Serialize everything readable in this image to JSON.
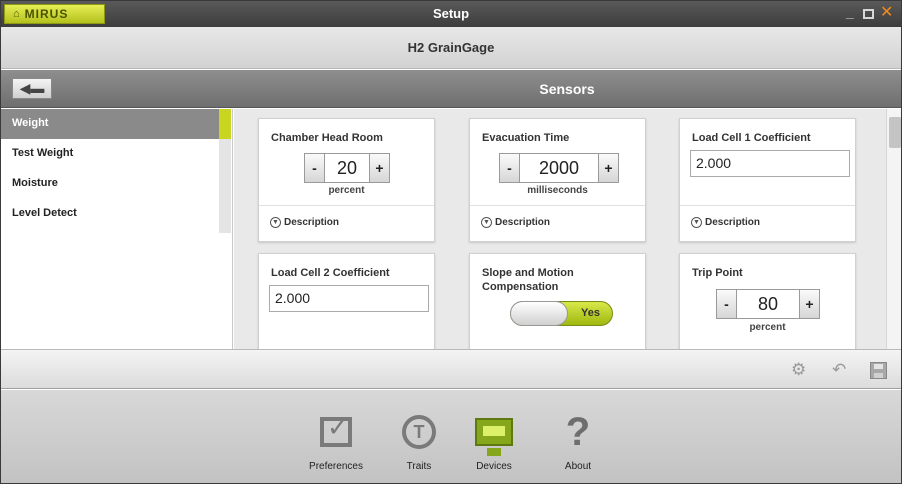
{
  "window": {
    "logo": "MIRUS",
    "title": "Setup"
  },
  "subtitle": "H2 GrainGage",
  "header": {
    "section_title": "Sensors"
  },
  "sidebar": {
    "items": [
      {
        "label": "Weight",
        "active": true
      },
      {
        "label": "Test Weight",
        "active": false
      },
      {
        "label": "Moisture",
        "active": false
      },
      {
        "label": "Level Detect",
        "active": false
      }
    ]
  },
  "cards": {
    "chamber_head_room": {
      "title": "Chamber Head Room",
      "value": "20",
      "unit": "percent",
      "description": "Description"
    },
    "evacuation_time": {
      "title": "Evacuation Time",
      "value": "2000",
      "unit": "milliseconds",
      "description": "Description"
    },
    "load_cell_1": {
      "title": "Load Cell 1 Coefficient",
      "value": "2.000",
      "description": "Description"
    },
    "load_cell_2": {
      "title": "Load Cell 2 Coefficient",
      "value": "2.000"
    },
    "slope_motion": {
      "title": "Slope and Motion Compensation",
      "toggle_label": "Yes"
    },
    "trip_point": {
      "title": "Trip Point",
      "value": "80",
      "unit": "percent"
    }
  },
  "stepper": {
    "minus": "-",
    "plus": "+"
  },
  "bottom_nav": {
    "items": [
      {
        "label": "Preferences",
        "icon": "preferences-icon"
      },
      {
        "label": "Traits",
        "icon": "traits-icon"
      },
      {
        "label": "Devices",
        "icon": "devices-icon"
      },
      {
        "label": "About",
        "icon": "about-icon"
      }
    ]
  },
  "colors": {
    "accent": "#c8d620",
    "devices_icon": "#86a61c",
    "close_button": "#f08a1c"
  }
}
